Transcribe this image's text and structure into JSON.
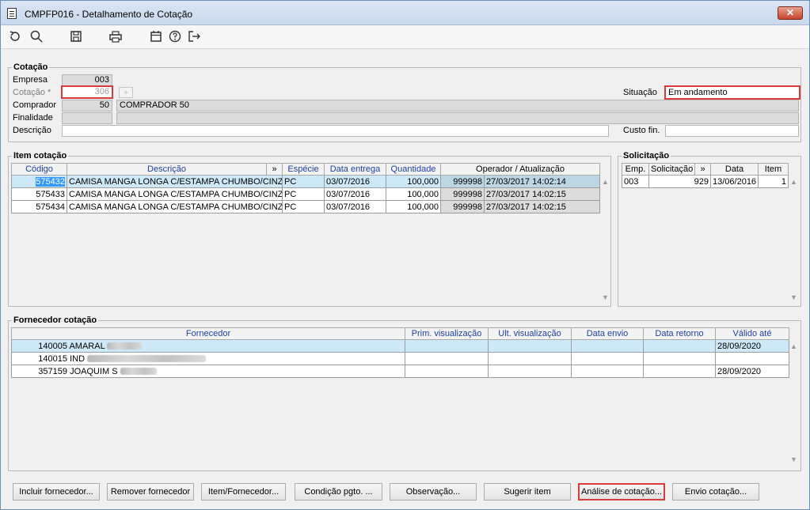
{
  "window": {
    "title": "CMPFP016 - Detalhamento de Cotação",
    "close_label": "✕"
  },
  "toolbar": {
    "icons": [
      "undo-icon",
      "search-icon",
      "save-icon",
      "print-icon",
      "calendar-icon",
      "help-icon",
      "exit-icon"
    ]
  },
  "cotacao": {
    "legend": "Cotação",
    "empresa_label": "Empresa",
    "empresa_value": "003",
    "cotacao_label": "Cotação *",
    "cotacao_value": "306",
    "comprador_label": "Comprador",
    "comprador_code": "50",
    "comprador_name": "COMPRADOR 50",
    "finalidade_label": "Finalidade",
    "descricao_label": "Descrição",
    "situacao_label": "Situação",
    "situacao_value": "Em andamento",
    "custo_label": "Custo fin."
  },
  "item_cotacao": {
    "legend": "Item cotação",
    "headers": {
      "codigo": "Código",
      "descricao": "Descrição",
      "more": "»",
      "especie": "Espécie",
      "data_entrega": "Data entrega",
      "quantidade": "Quantidade",
      "operador": "Operador / Atualização"
    },
    "rows": [
      {
        "codigo": "575432",
        "descricao": "CAMISA MANGA LONGA C/ESTAMPA CHUMBO/CINZA P(",
        "especie": "PC",
        "data_entrega": "03/07/2016",
        "quantidade": "100,000",
        "operador": "999998",
        "atualizacao": "27/03/2017 14:02:14"
      },
      {
        "codigo": "575433",
        "descricao": "CAMISA MANGA LONGA C/ESTAMPA CHUMBO/CINZA P",
        "especie": "PC",
        "data_entrega": "03/07/2016",
        "quantidade": "100,000",
        "operador": "999998",
        "atualizacao": "27/03/2017 14:02:15"
      },
      {
        "codigo": "575434",
        "descricao": "CAMISA MANGA LONGA C/ESTAMPA CHUMBO/CINZA M",
        "especie": "PC",
        "data_entrega": "03/07/2016",
        "quantidade": "100,000",
        "operador": "999998",
        "atualizacao": "27/03/2017 14:02:15"
      }
    ]
  },
  "solicitacao": {
    "legend": "Solicitação",
    "headers": {
      "emp": "Emp.",
      "solicitacao": "Solicitação",
      "more": "»",
      "data": "Data",
      "item": "Item"
    },
    "rows": [
      {
        "emp": "003",
        "solicitacao": "929",
        "data": "13/06/2016",
        "item": "1"
      }
    ]
  },
  "fornecedor": {
    "legend": "Fornecedor cotação",
    "headers": {
      "fornecedor": "Fornecedor",
      "prim": "Prim. visualização",
      "ult": "Ult. visualização",
      "envio": "Data envio",
      "retorno": "Data retorno",
      "valido": "Válido até"
    },
    "rows": [
      {
        "codigo": "140005",
        "nome": "AMARAL",
        "valido": "28/09/2020"
      },
      {
        "codigo": "140015",
        "nome": "IND",
        "valido": ""
      },
      {
        "codigo": "357159",
        "nome": "JOAQUIM S",
        "valido": "28/09/2020"
      }
    ]
  },
  "buttons": {
    "incluir": "Incluir fornecedor...",
    "remover": "Remover fornecedor",
    "item_fornecedor": "Item/Fornecedor...",
    "condicao": "Condição pgto. ...",
    "observacao": "Observação...",
    "sugerir": "Sugerir item",
    "analise": "Análise de cotação...",
    "envio": "Envio cotação..."
  }
}
